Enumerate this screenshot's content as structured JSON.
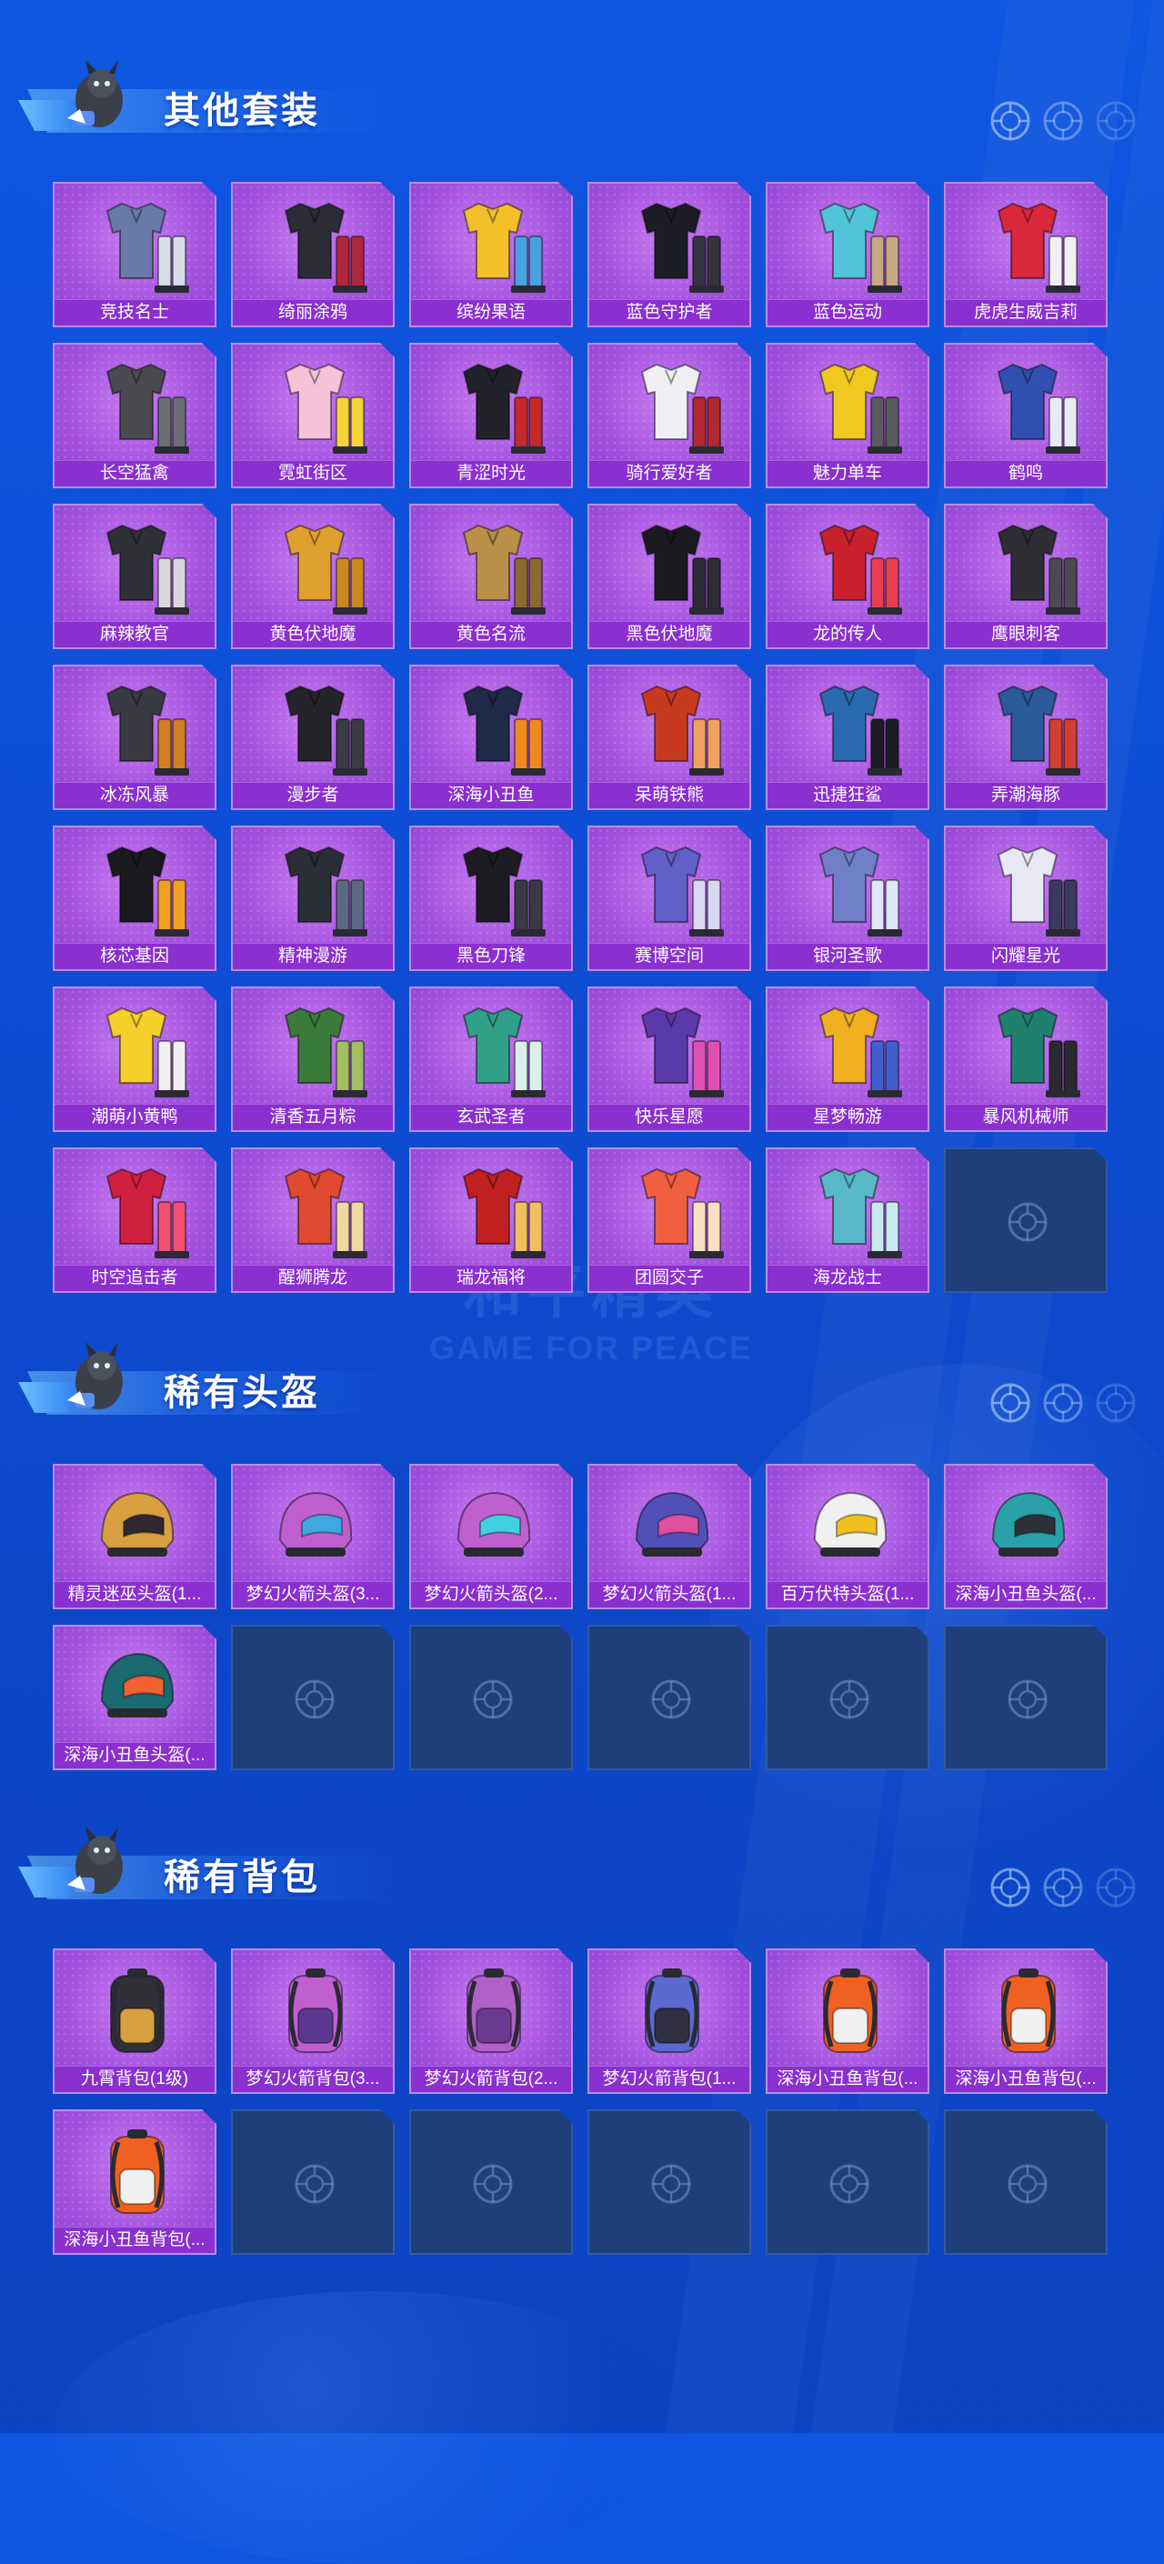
{
  "colors": {
    "background": "#0e4ed6",
    "card_purple": "#a554e0",
    "card_label": "#8a2fd0",
    "empty_slot": "#1e3f7a"
  },
  "background_text": {
    "line1": "和平精英",
    "line2": "GAME FOR PEACE"
  },
  "sections": [
    {
      "title": "其他套装",
      "icons": [
        "crosshair-icon",
        "crosshair-icon",
        "crosshair-icon"
      ],
      "items": [
        {
          "label": "竞技名士",
          "icon": "outfit"
        },
        {
          "label": "绮丽涂鸦",
          "icon": "outfit"
        },
        {
          "label": "缤纷果语",
          "icon": "outfit"
        },
        {
          "label": "蓝色守护者",
          "icon": "outfit"
        },
        {
          "label": "蓝色运动",
          "icon": "outfit"
        },
        {
          "label": "虎虎生威吉莉",
          "icon": "outfit"
        },
        {
          "label": "长空猛禽",
          "icon": "outfit"
        },
        {
          "label": "霓虹街区",
          "icon": "outfit"
        },
        {
          "label": "青涩时光",
          "icon": "outfit"
        },
        {
          "label": "骑行爱好者",
          "icon": "outfit"
        },
        {
          "label": "魅力单车",
          "icon": "outfit"
        },
        {
          "label": "鹤鸣",
          "icon": "outfit"
        },
        {
          "label": "麻辣教官",
          "icon": "outfit"
        },
        {
          "label": "黄色伏地魔",
          "icon": "outfit"
        },
        {
          "label": "黄色名流",
          "icon": "outfit"
        },
        {
          "label": "黑色伏地魔",
          "icon": "outfit"
        },
        {
          "label": "龙的传人",
          "icon": "outfit"
        },
        {
          "label": "鹰眼刺客",
          "icon": "outfit"
        },
        {
          "label": "冰冻风暴",
          "icon": "outfit"
        },
        {
          "label": "漫步者",
          "icon": "outfit"
        },
        {
          "label": "深海小丑鱼",
          "icon": "outfit"
        },
        {
          "label": "呆萌铁熊",
          "icon": "outfit"
        },
        {
          "label": "迅捷狂鲨",
          "icon": "outfit"
        },
        {
          "label": "弄潮海豚",
          "icon": "outfit"
        },
        {
          "label": "核芯基因",
          "icon": "outfit"
        },
        {
          "label": "精神漫游",
          "icon": "outfit"
        },
        {
          "label": "黑色刀锋",
          "icon": "outfit"
        },
        {
          "label": "赛博空间",
          "icon": "outfit"
        },
        {
          "label": "银河圣歌",
          "icon": "outfit"
        },
        {
          "label": "闪耀星光",
          "icon": "outfit"
        },
        {
          "label": "潮萌小黄鸭",
          "icon": "outfit"
        },
        {
          "label": "清香五月粽",
          "icon": "outfit"
        },
        {
          "label": "玄武圣者",
          "icon": "outfit"
        },
        {
          "label": "快乐星愿",
          "icon": "outfit"
        },
        {
          "label": "星梦畅游",
          "icon": "outfit"
        },
        {
          "label": "暴风机械师",
          "icon": "outfit"
        },
        {
          "label": "时空追击者",
          "icon": "outfit"
        },
        {
          "label": "醒狮腾龙",
          "icon": "outfit"
        },
        {
          "label": "瑞龙福将",
          "icon": "outfit"
        },
        {
          "label": "团圆交子",
          "icon": "outfit"
        },
        {
          "label": "海龙战士",
          "icon": "outfit"
        }
      ],
      "empty_slots": 1
    },
    {
      "title": "稀有头盔",
      "icons": [
        "crosshair-icon",
        "crosshair-icon",
        "crosshair-icon"
      ],
      "items": [
        {
          "label": "精灵迷巫头盔(1...",
          "icon": "helmet"
        },
        {
          "label": "梦幻火箭头盔(3...",
          "icon": "helmet"
        },
        {
          "label": "梦幻火箭头盔(2...",
          "icon": "helmet"
        },
        {
          "label": "梦幻火箭头盔(1...",
          "icon": "helmet"
        },
        {
          "label": "百万伏特头盔(1...",
          "icon": "helmet"
        },
        {
          "label": "深海小丑鱼头盔(...",
          "icon": "helmet"
        },
        {
          "label": "深海小丑鱼头盔(...",
          "icon": "helmet"
        }
      ],
      "empty_slots": 5
    },
    {
      "title": "稀有背包",
      "icons": [
        "crosshair-icon",
        "crosshair-icon",
        "crosshair-icon"
      ],
      "items": [
        {
          "label": "九霄背包(1级)",
          "icon": "backpack"
        },
        {
          "label": "梦幻火箭背包(3...",
          "icon": "backpack"
        },
        {
          "label": "梦幻火箭背包(2...",
          "icon": "backpack"
        },
        {
          "label": "梦幻火箭背包(1...",
          "icon": "backpack"
        },
        {
          "label": "深海小丑鱼背包(...",
          "icon": "backpack"
        },
        {
          "label": "深海小丑鱼背包(...",
          "icon": "backpack"
        },
        {
          "label": "深海小丑鱼背包(...",
          "icon": "backpack"
        }
      ],
      "empty_slots": 5
    }
  ]
}
